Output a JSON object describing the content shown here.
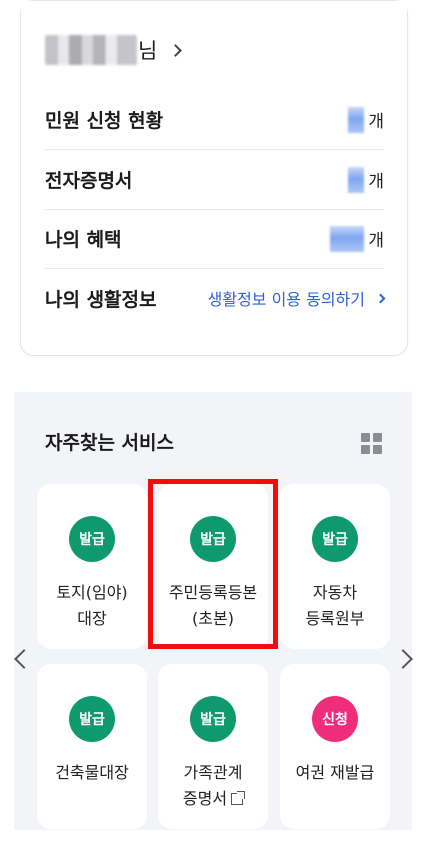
{
  "profile": {
    "name_suffix": "님"
  },
  "status_rows": [
    {
      "label": "민원 신청 현황",
      "unit": "개"
    },
    {
      "label": "전자증명서",
      "unit": "개"
    },
    {
      "label": "나의 혜택",
      "unit": "개"
    }
  ],
  "life_info": {
    "label": "나의 생활정보",
    "link": "생활정보 이용 동의하기"
  },
  "services": {
    "title": "자주찾는 서비스",
    "items": [
      {
        "badge": "발급",
        "label": "토지(임야)\n대장",
        "badge_color": "#0f9a6e"
      },
      {
        "badge": "발급",
        "label": "주민등록등본\n(초본)",
        "badge_color": "#0f9a6e"
      },
      {
        "badge": "발급",
        "label": "자동차\n등록원부",
        "badge_color": "#0f9a6e"
      },
      {
        "badge": "발급",
        "label": "건축물대장",
        "badge_color": "#0f9a6e"
      },
      {
        "badge": "발급",
        "label": "가족관계\n증명서",
        "badge_color": "#0f9a6e"
      },
      {
        "badge": "신청",
        "label": "여권 재발급",
        "badge_color": "#ef2d7a"
      }
    ]
  },
  "colors": {
    "accent_link": "#2f61d9",
    "highlight": "#f20d0d",
    "section_bg": "#f2f4f7"
  },
  "icons": [
    "chevron-right-icon",
    "grid-menu-icon",
    "external-link-icon",
    "chevron-left-icon"
  ]
}
